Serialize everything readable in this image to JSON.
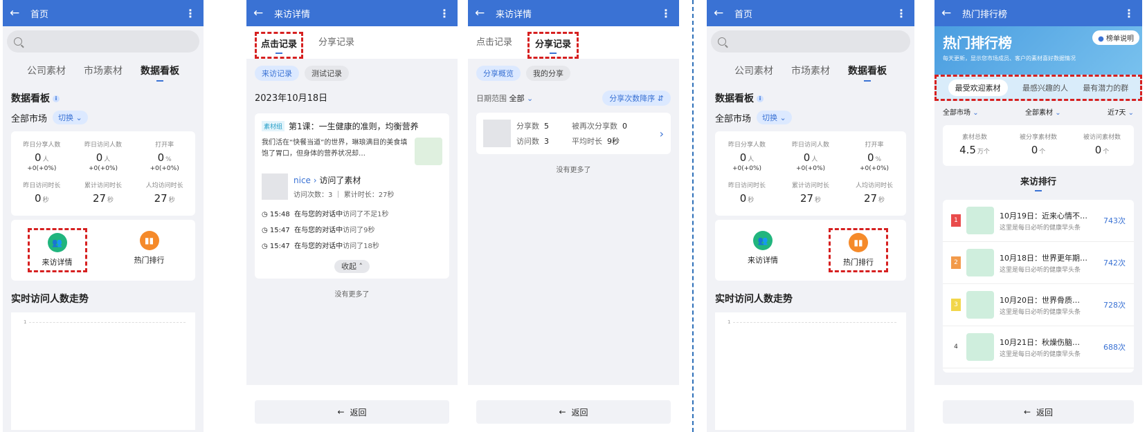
{
  "panel1": {
    "topbar_title": "首页",
    "tabs": [
      "公司素材",
      "市场素材",
      "数据看板"
    ],
    "section_title": "数据看板",
    "market_label": "全部市场",
    "switch_label": "切换",
    "stats": [
      {
        "label": "昨日分享人数",
        "value": "0",
        "unit": "人",
        "delta": "+0(+0%)"
      },
      {
        "label": "昨日访问人数",
        "value": "0",
        "unit": "人",
        "delta": "+0(+0%)"
      },
      {
        "label": "打开率",
        "value": "0",
        "unit": "%",
        "delta": "+0(+0%)"
      },
      {
        "label": "昨日访问时长",
        "value": "0",
        "unit": "秒",
        "delta": ""
      },
      {
        "label": "累计访问时长",
        "value": "27",
        "unit": "秒",
        "delta": ""
      },
      {
        "label": "人均访问时长",
        "value": "27",
        "unit": "秒",
        "delta": ""
      }
    ],
    "quick": [
      {
        "label": "来访详情"
      },
      {
        "label": "热门排行"
      }
    ],
    "chart_title": "实时访问人数走势",
    "chart_tick": "1"
  },
  "panel2": {
    "topbar_title": "来访详情",
    "subtabs": [
      "点击记录",
      "分享记录"
    ],
    "chips": [
      "来访记录",
      "测试记录"
    ],
    "date": "2023年10月18日",
    "tag": "素材组",
    "article_title": "第1课：一生健康的准则，均衡营养",
    "article_desc": "我们活在“快餐当道”的世界，琳琅满目的美食填饱了胃口，但身体的营养状况却…",
    "visitor_name": "nice",
    "visitor_action": "访问了素材",
    "visit_count": "访问次数：3",
    "visit_time": "累计时长：27秒",
    "records": [
      {
        "time": "15:48",
        "prefix": "在与您的对话中",
        "action": "访问了不足1秒"
      },
      {
        "time": "15:47",
        "prefix": "在与您的对话中",
        "action": "访问了9秒"
      },
      {
        "time": "15:47",
        "prefix": "在与您的对话中",
        "action": "访问了18秒"
      }
    ],
    "collapse": "收起",
    "no_more": "没有更多了",
    "back": "返回"
  },
  "panel3": {
    "topbar_title": "来访详情",
    "subtabs": [
      "点击记录",
      "分享记录"
    ],
    "chips": [
      "分享概览",
      "我的分享"
    ],
    "date_range_label": "日期范围",
    "date_range_value": "全部",
    "sort_label": "分享次数降序",
    "share_count_label": "分享数",
    "share_count": "5",
    "reshare_label": "被再次分享数",
    "reshare": "0",
    "visit_label": "访问数",
    "visit": "3",
    "avg_label": "平均时长",
    "avg": "9秒",
    "no_more": "没有更多了",
    "back": "返回"
  },
  "panel4": {
    "topbar_title": "首页",
    "tabs": [
      "公司素材",
      "市场素材",
      "数据看板"
    ],
    "section_title": "数据看板",
    "market_label": "全部市场",
    "switch_label": "切换",
    "stats": [
      {
        "label": "昨日分享人数",
        "value": "0",
        "unit": "人",
        "delta": "+0(+0%)"
      },
      {
        "label": "昨日访问人数",
        "value": "0",
        "unit": "人",
        "delta": "+0(+0%)"
      },
      {
        "label": "打开率",
        "value": "0",
        "unit": "%",
        "delta": "+0(+0%)"
      },
      {
        "label": "昨日访问时长",
        "value": "0",
        "unit": "秒",
        "delta": ""
      },
      {
        "label": "累计访问时长",
        "value": "27",
        "unit": "秒",
        "delta": ""
      },
      {
        "label": "人均访问时长",
        "value": "27",
        "unit": "秒",
        "delta": ""
      }
    ],
    "quick": [
      {
        "label": "来访详情"
      },
      {
        "label": "热门排行"
      }
    ],
    "chart_title": "实时访问人数走势",
    "chart_tick": "1"
  },
  "panel5": {
    "topbar_title": "热门排行榜",
    "hero_title": "热门排行榜",
    "hero_sub": "每天更新，显示您市场成员、客户的素材喜好数据情况",
    "rule_button": "榜单说明",
    "tabs": [
      "最受欢迎素材",
      "最感兴趣的人",
      "最有潜力的群"
    ],
    "filters": [
      "全部市场",
      "全部素材",
      "近7天"
    ],
    "summary": [
      {
        "label": "素材总数",
        "value": "4.5",
        "unit": "万个"
      },
      {
        "label": "被分享素材数",
        "value": "0",
        "unit": "个"
      },
      {
        "label": "被访问素材数",
        "value": "0",
        "unit": "个"
      }
    ],
    "rank_title": "来访排行",
    "rows": [
      {
        "rank": "1",
        "title": "10月19日：近来心情不…",
        "desc": "这里是每日必听的健康早头条",
        "count": "743次"
      },
      {
        "rank": "2",
        "title": "10月18日：世界更年期…",
        "desc": "这里是每日必听的健康早头条",
        "count": "742次"
      },
      {
        "rank": "3",
        "title": "10月20日：世界骨质…",
        "desc": "这里是每日必听的健康早头条",
        "count": "728次"
      },
      {
        "rank": "4",
        "title": "10月21日：秋燥伤脑…",
        "desc": "这里是每日必听的健康早头条",
        "count": "688次"
      }
    ],
    "back": "返回"
  },
  "colors": {
    "primary": "#3a72d4",
    "highlight": "#d62020",
    "green": "#21b57e",
    "orange": "#f58a2a",
    "rank_count": "#3a72d4"
  }
}
